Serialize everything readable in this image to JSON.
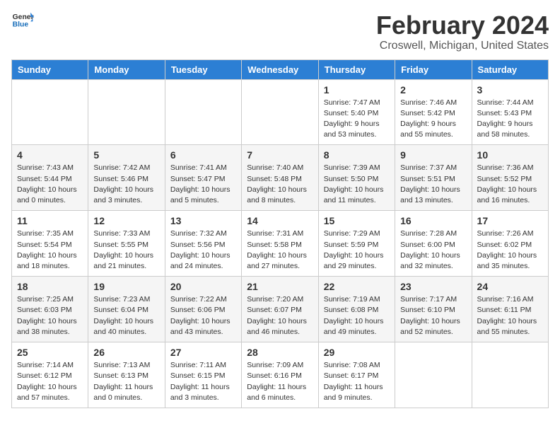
{
  "logo": {
    "line1": "General",
    "line2": "Blue"
  },
  "title": "February 2024",
  "subtitle": "Croswell, Michigan, United States",
  "days_of_week": [
    "Sunday",
    "Monday",
    "Tuesday",
    "Wednesday",
    "Thursday",
    "Friday",
    "Saturday"
  ],
  "weeks": [
    [
      {
        "day": "",
        "info": ""
      },
      {
        "day": "",
        "info": ""
      },
      {
        "day": "",
        "info": ""
      },
      {
        "day": "",
        "info": ""
      },
      {
        "day": "1",
        "info": "Sunrise: 7:47 AM\nSunset: 5:40 PM\nDaylight: 9 hours\nand 53 minutes."
      },
      {
        "day": "2",
        "info": "Sunrise: 7:46 AM\nSunset: 5:42 PM\nDaylight: 9 hours\nand 55 minutes."
      },
      {
        "day": "3",
        "info": "Sunrise: 7:44 AM\nSunset: 5:43 PM\nDaylight: 9 hours\nand 58 minutes."
      }
    ],
    [
      {
        "day": "4",
        "info": "Sunrise: 7:43 AM\nSunset: 5:44 PM\nDaylight: 10 hours\nand 0 minutes."
      },
      {
        "day": "5",
        "info": "Sunrise: 7:42 AM\nSunset: 5:46 PM\nDaylight: 10 hours\nand 3 minutes."
      },
      {
        "day": "6",
        "info": "Sunrise: 7:41 AM\nSunset: 5:47 PM\nDaylight: 10 hours\nand 5 minutes."
      },
      {
        "day": "7",
        "info": "Sunrise: 7:40 AM\nSunset: 5:48 PM\nDaylight: 10 hours\nand 8 minutes."
      },
      {
        "day": "8",
        "info": "Sunrise: 7:39 AM\nSunset: 5:50 PM\nDaylight: 10 hours\nand 11 minutes."
      },
      {
        "day": "9",
        "info": "Sunrise: 7:37 AM\nSunset: 5:51 PM\nDaylight: 10 hours\nand 13 minutes."
      },
      {
        "day": "10",
        "info": "Sunrise: 7:36 AM\nSunset: 5:52 PM\nDaylight: 10 hours\nand 16 minutes."
      }
    ],
    [
      {
        "day": "11",
        "info": "Sunrise: 7:35 AM\nSunset: 5:54 PM\nDaylight: 10 hours\nand 18 minutes."
      },
      {
        "day": "12",
        "info": "Sunrise: 7:33 AM\nSunset: 5:55 PM\nDaylight: 10 hours\nand 21 minutes."
      },
      {
        "day": "13",
        "info": "Sunrise: 7:32 AM\nSunset: 5:56 PM\nDaylight: 10 hours\nand 24 minutes."
      },
      {
        "day": "14",
        "info": "Sunrise: 7:31 AM\nSunset: 5:58 PM\nDaylight: 10 hours\nand 27 minutes."
      },
      {
        "day": "15",
        "info": "Sunrise: 7:29 AM\nSunset: 5:59 PM\nDaylight: 10 hours\nand 29 minutes."
      },
      {
        "day": "16",
        "info": "Sunrise: 7:28 AM\nSunset: 6:00 PM\nDaylight: 10 hours\nand 32 minutes."
      },
      {
        "day": "17",
        "info": "Sunrise: 7:26 AM\nSunset: 6:02 PM\nDaylight: 10 hours\nand 35 minutes."
      }
    ],
    [
      {
        "day": "18",
        "info": "Sunrise: 7:25 AM\nSunset: 6:03 PM\nDaylight: 10 hours\nand 38 minutes."
      },
      {
        "day": "19",
        "info": "Sunrise: 7:23 AM\nSunset: 6:04 PM\nDaylight: 10 hours\nand 40 minutes."
      },
      {
        "day": "20",
        "info": "Sunrise: 7:22 AM\nSunset: 6:06 PM\nDaylight: 10 hours\nand 43 minutes."
      },
      {
        "day": "21",
        "info": "Sunrise: 7:20 AM\nSunset: 6:07 PM\nDaylight: 10 hours\nand 46 minutes."
      },
      {
        "day": "22",
        "info": "Sunrise: 7:19 AM\nSunset: 6:08 PM\nDaylight: 10 hours\nand 49 minutes."
      },
      {
        "day": "23",
        "info": "Sunrise: 7:17 AM\nSunset: 6:10 PM\nDaylight: 10 hours\nand 52 minutes."
      },
      {
        "day": "24",
        "info": "Sunrise: 7:16 AM\nSunset: 6:11 PM\nDaylight: 10 hours\nand 55 minutes."
      }
    ],
    [
      {
        "day": "25",
        "info": "Sunrise: 7:14 AM\nSunset: 6:12 PM\nDaylight: 10 hours\nand 57 minutes."
      },
      {
        "day": "26",
        "info": "Sunrise: 7:13 AM\nSunset: 6:13 PM\nDaylight: 11 hours\nand 0 minutes."
      },
      {
        "day": "27",
        "info": "Sunrise: 7:11 AM\nSunset: 6:15 PM\nDaylight: 11 hours\nand 3 minutes."
      },
      {
        "day": "28",
        "info": "Sunrise: 7:09 AM\nSunset: 6:16 PM\nDaylight: 11 hours\nand 6 minutes."
      },
      {
        "day": "29",
        "info": "Sunrise: 7:08 AM\nSunset: 6:17 PM\nDaylight: 11 hours\nand 9 minutes."
      },
      {
        "day": "",
        "info": ""
      },
      {
        "day": "",
        "info": ""
      }
    ]
  ]
}
